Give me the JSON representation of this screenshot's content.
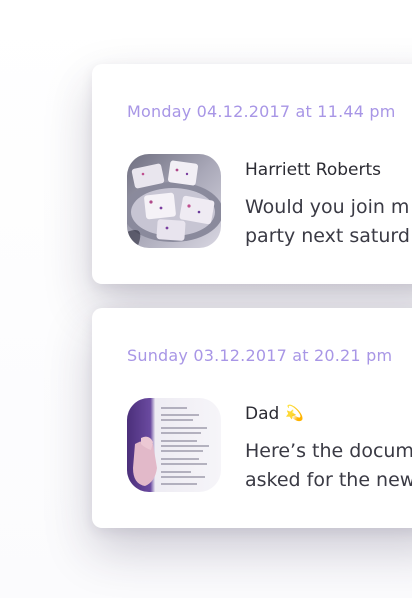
{
  "messages": [
    {
      "date": "Monday 04.12.2017 at 11.44 pm",
      "sender": "Harriett Roberts",
      "sender_emoji": "",
      "text_line1": "Would you join m",
      "text_line2": "party next saturd",
      "thumbnail": "cake-photo"
    },
    {
      "date": "Sunday 03.12.2017 at 20.21 pm",
      "sender": "Dad",
      "sender_emoji": "💫",
      "text_line1": "Here’s the docum",
      "text_line2": "asked for the new",
      "thumbnail": "document-photo"
    }
  ],
  "colors": {
    "date_accent": "#a896e6",
    "sender_text": "#2b2b33",
    "message_text": "#3a3a44",
    "card_bg": "#ffffff"
  }
}
